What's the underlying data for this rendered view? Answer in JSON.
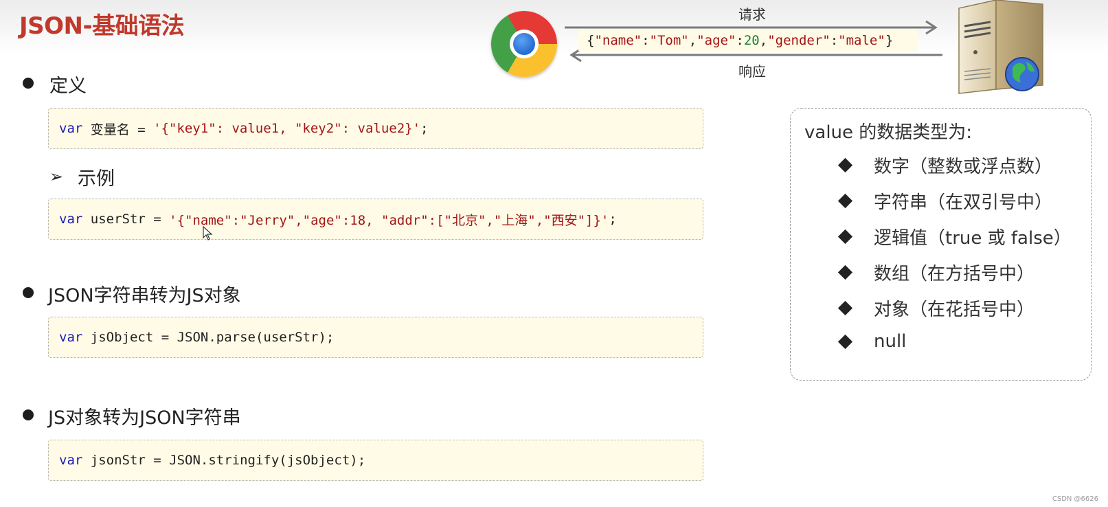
{
  "title": "JSON-基础语法",
  "diagram": {
    "request_label": "请求",
    "response_label": "响应",
    "json_parts": {
      "open": "{",
      "k_name": "\"name\"",
      "colon": ":",
      "v_name": "\"Tom\"",
      "comma": ",",
      "k_age": "\"age\"",
      "v_age": "20",
      "k_gender": "\"gender\"",
      "v_gender": "\"male\"",
      "close": "}"
    }
  },
  "sections": {
    "definition": {
      "heading": "定义",
      "code": {
        "kw": "var",
        "rest": " 变量名 = ",
        "str": "'{\"key1\": value1, \"key2\": value2}'",
        "end": ";"
      }
    },
    "example": {
      "heading": "示例",
      "code": {
        "kw": "var",
        "rest": " userStr = ",
        "str": "'{\"name\":\"Jerry\",\"age\":18, \"addr\":[\"北京\",\"上海\",\"西安\"]}'",
        "end": ";"
      }
    },
    "parse": {
      "heading": "JSON字符串转为JS对象",
      "code": {
        "kw": "var",
        "rest": " jsObject = JSON.parse(userStr);"
      }
    },
    "stringify": {
      "heading": "JS对象转为JSON字符串",
      "code": {
        "kw": "var",
        "rest": " jsonStr = JSON.stringify(jsObject);"
      }
    }
  },
  "value_types": {
    "title": "value 的数据类型为:",
    "items": [
      "数字（整数或浮点数）",
      "字符串（在双引号中）",
      "逻辑值（true 或 false）",
      "数组（在方括号中）",
      "对象（在花括号中）",
      "null"
    ]
  },
  "watermark": "CSDN @6626",
  "icons": {
    "browser": "chrome-icon",
    "server": "server-globe-icon"
  },
  "colors": {
    "title": "#c0392b",
    "keyword": "#1a1ab8",
    "string": "#a31515",
    "number": "#188038",
    "code_bg": "#fffbe6"
  }
}
